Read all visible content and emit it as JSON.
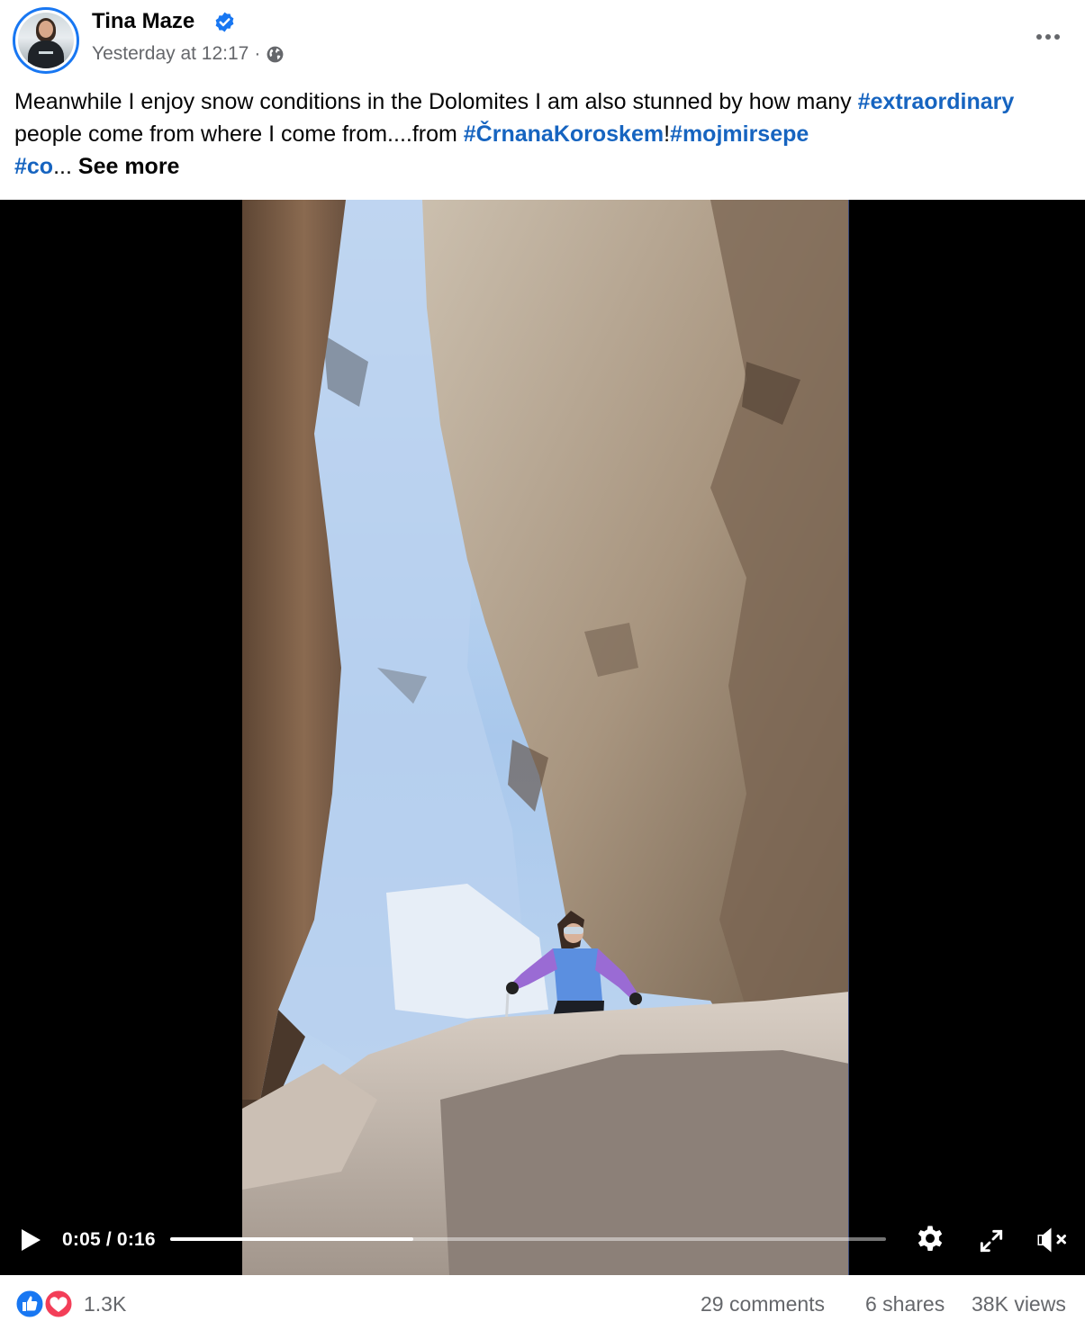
{
  "post": {
    "author": "Tina Maze",
    "timestamp": "Yesterday at 12:17",
    "separator": "·",
    "verified": true,
    "caption": {
      "text1": "Meanwhile I enjoy snow conditions in the Dolomites I am also stunned by how many ",
      "hashtag1": "#extraordinary",
      "text2": " people come from where I come from....from ",
      "hashtag2": "#ČrnanaKoroskem",
      "text3": "!",
      "hashtag3": "#mojmirsepe",
      "hashtag4": "#co",
      "ellipsis": "... ",
      "see_more": "See more"
    }
  },
  "video": {
    "time": "0:05 / 0:16",
    "progress": 0.34,
    "muted": true
  },
  "footer": {
    "reactions_count": "1.3K",
    "comments": "29 comments",
    "shares": "6 shares",
    "views": "38K views"
  },
  "colors": {
    "link": "#1664c0",
    "verified": "#1877f2",
    "muted_text": "#65676b",
    "like": "#1877f2",
    "love": "#f33e58"
  },
  "icons": [
    "verified-badge-icon",
    "globe-icon",
    "more-icon",
    "play-icon",
    "settings-icon",
    "fullscreen-icon",
    "mute-icon",
    "like-reaction-icon",
    "love-reaction-icon"
  ]
}
